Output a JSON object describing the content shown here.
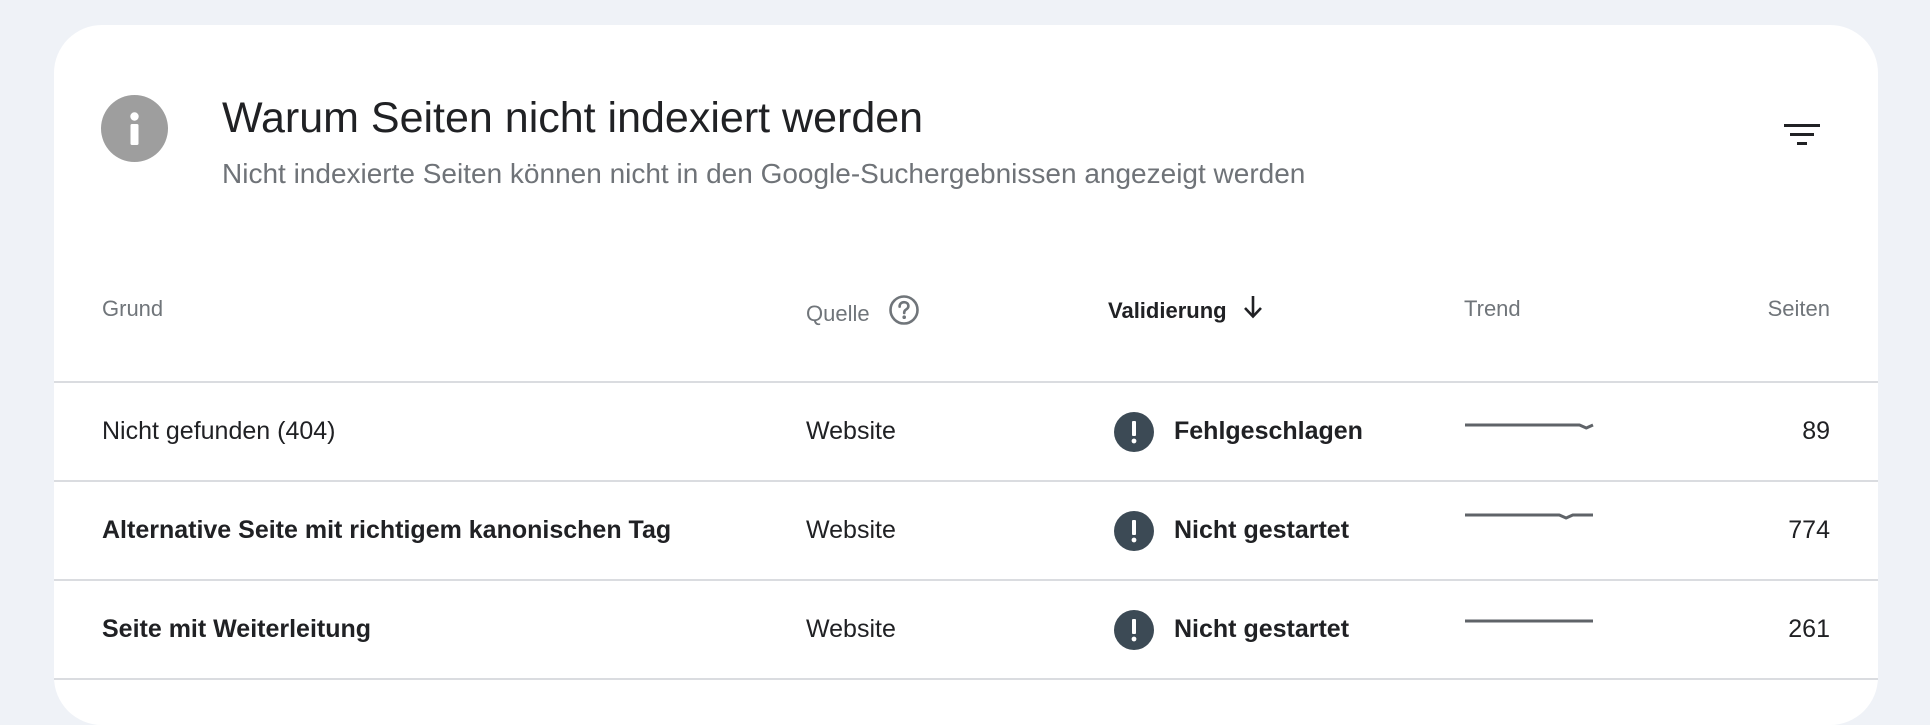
{
  "header": {
    "icon": "info-icon",
    "title": "Warum Seiten nicht indexiert werden",
    "subtitle": "Nicht indexierte Seiten können nicht in den Google-Suchergebnissen angezeigt werden",
    "filter_icon": "filter-icon"
  },
  "table": {
    "columns": {
      "grund": "Grund",
      "quelle": "Quelle",
      "validierung": "Validierung",
      "trend": "Trend",
      "seiten": "Seiten"
    },
    "rows": [
      {
        "grund": "Nicht gefunden (404)",
        "quelle": "Website",
        "validierung": "Fehlgeschlagen",
        "seiten": "89",
        "trend": [
          3,
          3,
          3,
          3,
          3,
          3,
          3,
          3,
          3,
          3,
          3,
          3,
          3,
          3,
          3,
          3,
          3,
          3,
          2,
          3
        ]
      },
      {
        "grund": "Alternative Seite mit richtigem kanonischen Tag",
        "quelle": "Website",
        "validierung": "Nicht gestartet",
        "seiten": "774",
        "trend": [
          4,
          4,
          4,
          4,
          4,
          4,
          4,
          4,
          4,
          4,
          4,
          4,
          4,
          4,
          4,
          3,
          4,
          4,
          4,
          4
        ]
      },
      {
        "grund": "Seite mit Weiterleitung",
        "quelle": "Website",
        "validierung": "Nicht gestartet",
        "seiten": "261",
        "trend": [
          3,
          3,
          3,
          3,
          3,
          3,
          3,
          3,
          3,
          3,
          3,
          3,
          3,
          3,
          3,
          3,
          3,
          3,
          3,
          3
        ]
      }
    ]
  },
  "colors": {
    "background": "#eff2f7",
    "card": "#ffffff",
    "info_icon": "#9e9e9e",
    "status_icon": "#3c4a55",
    "trend_line": "#5f6368",
    "divider": "#dadce0"
  }
}
